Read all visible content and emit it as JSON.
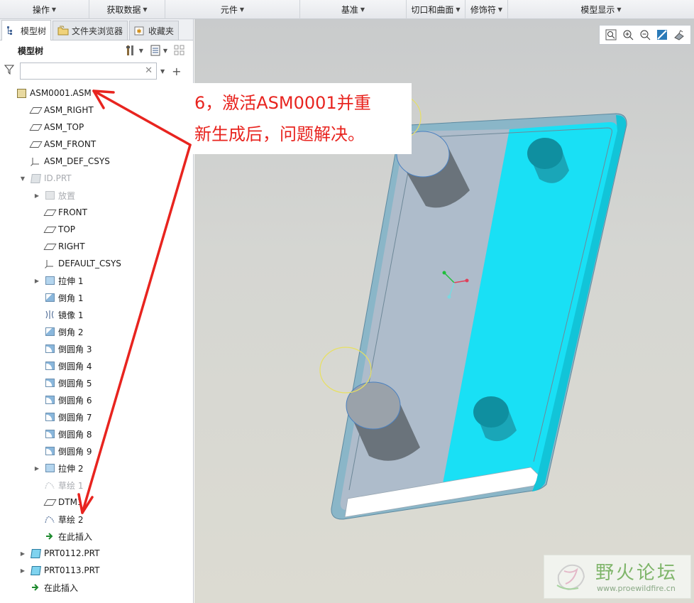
{
  "ribbon": {
    "groups": [
      {
        "label": "操作"
      },
      {
        "label": "获取数据"
      },
      {
        "label": "元件"
      },
      {
        "label": "基准"
      },
      {
        "label": "切口和曲面"
      },
      {
        "label": "修饰符"
      },
      {
        "label": "模型显示"
      }
    ]
  },
  "tabs": [
    {
      "label": "模型树",
      "active": true
    },
    {
      "label": "文件夹浏览器",
      "active": false
    },
    {
      "label": "收藏夹",
      "active": false
    }
  ],
  "tree": {
    "title": "模型树",
    "filter_value": "",
    "items": [
      {
        "label": "ASM0001.ASM",
        "icon": "assembly-icon",
        "indent": 0,
        "expander": "",
        "dim": false
      },
      {
        "label": "ASM_RIGHT",
        "icon": "datum-plane-icon",
        "indent": 1,
        "expander": "",
        "dim": false
      },
      {
        "label": "ASM_TOP",
        "icon": "datum-plane-icon",
        "indent": 1,
        "expander": "",
        "dim": false
      },
      {
        "label": "ASM_FRONT",
        "icon": "datum-plane-icon",
        "indent": 1,
        "expander": "",
        "dim": false
      },
      {
        "label": "ASM_DEF_CSYS",
        "icon": "csys-icon",
        "indent": 1,
        "expander": "",
        "dim": false
      },
      {
        "label": "ID.PRT",
        "icon": "part-icon",
        "indent": 1,
        "expander": "▼",
        "dim": true
      },
      {
        "label": "放置",
        "icon": "placement-icon",
        "indent": 2,
        "expander": "▶",
        "dim": true
      },
      {
        "label": "FRONT",
        "icon": "datum-plane-icon",
        "indent": 2,
        "expander": "",
        "dim": false
      },
      {
        "label": "TOP",
        "icon": "datum-plane-icon",
        "indent": 2,
        "expander": "",
        "dim": false
      },
      {
        "label": "RIGHT",
        "icon": "datum-plane-icon",
        "indent": 2,
        "expander": "",
        "dim": false
      },
      {
        "label": "DEFAULT_CSYS",
        "icon": "csys-icon",
        "indent": 2,
        "expander": "",
        "dim": false
      },
      {
        "label": "拉伸 1",
        "icon": "extrude-icon",
        "indent": 2,
        "expander": "▶",
        "dim": false
      },
      {
        "label": "倒角 1",
        "icon": "chamfer-icon",
        "indent": 2,
        "expander": "",
        "dim": false
      },
      {
        "label": "镜像 1",
        "icon": "mirror-icon",
        "indent": 2,
        "expander": "",
        "dim": false
      },
      {
        "label": "倒角 2",
        "icon": "chamfer-icon",
        "indent": 2,
        "expander": "",
        "dim": false
      },
      {
        "label": "倒圆角 3",
        "icon": "round-icon",
        "indent": 2,
        "expander": "",
        "dim": false
      },
      {
        "label": "倒圆角 4",
        "icon": "round-icon",
        "indent": 2,
        "expander": "",
        "dim": false
      },
      {
        "label": "倒圆角 5",
        "icon": "round-icon",
        "indent": 2,
        "expander": "",
        "dim": false
      },
      {
        "label": "倒圆角 6",
        "icon": "round-icon",
        "indent": 2,
        "expander": "",
        "dim": false
      },
      {
        "label": "倒圆角 7",
        "icon": "round-icon",
        "indent": 2,
        "expander": "",
        "dim": false
      },
      {
        "label": "倒圆角 8",
        "icon": "round-icon",
        "indent": 2,
        "expander": "",
        "dim": false
      },
      {
        "label": "倒圆角 9",
        "icon": "round-icon",
        "indent": 2,
        "expander": "",
        "dim": false
      },
      {
        "label": "拉伸 2",
        "icon": "extrude-icon",
        "indent": 2,
        "expander": "▶",
        "dim": false
      },
      {
        "label": "草绘 1",
        "icon": "sketch-icon",
        "indent": 2,
        "expander": "",
        "dim": true
      },
      {
        "label": "DTM1",
        "icon": "datum-plane-icon",
        "indent": 2,
        "expander": "",
        "dim": false
      },
      {
        "label": "草绘 2",
        "icon": "sketch-icon",
        "indent": 2,
        "expander": "",
        "dim": false
      },
      {
        "label": "在此插入",
        "icon": "insert-here-icon",
        "indent": 2,
        "expander": "",
        "dim": false
      },
      {
        "label": "PRT0112.PRT",
        "icon": "part-icon",
        "indent": 1,
        "expander": "▶",
        "dim": false
      },
      {
        "label": "PRT0113.PRT",
        "icon": "part-icon",
        "indent": 1,
        "expander": "▶",
        "dim": false
      },
      {
        "label": "在此插入",
        "icon": "insert-here-icon",
        "indent": 1,
        "expander": "",
        "dim": false
      }
    ]
  },
  "callout": {
    "line1": "6，激活ASM0001并重",
    "line2": "新生成后，问题解决。"
  },
  "watermark": {
    "name": "野火论坛",
    "url": "www.proewildfire.cn"
  },
  "colors": {
    "annotation": "#e8241f",
    "part_highlight": "#19e0f5",
    "part_body": "#aebccb"
  }
}
